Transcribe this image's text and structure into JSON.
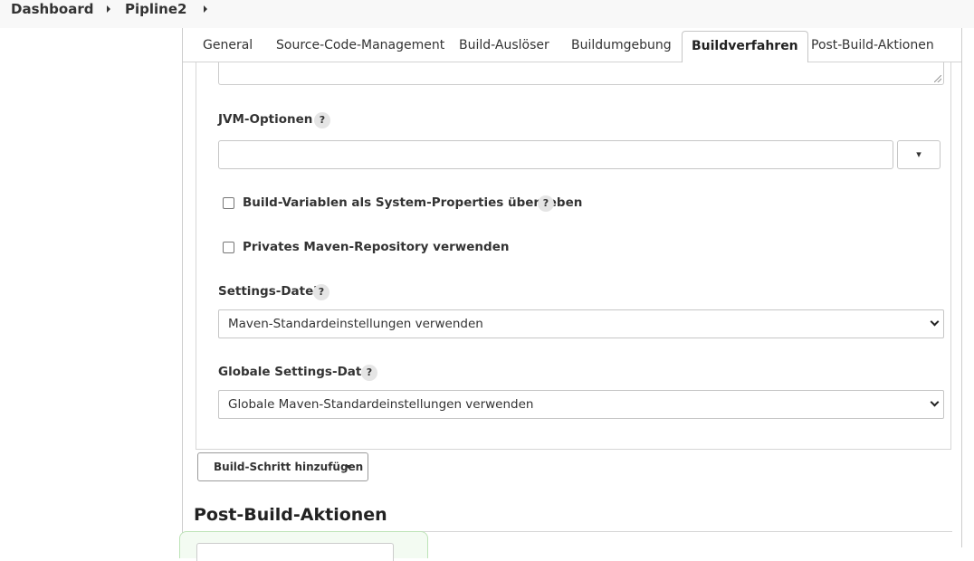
{
  "breadcrumb": {
    "items": [
      "Dashboard",
      "Pipline2"
    ]
  },
  "tabs": [
    {
      "label": "General"
    },
    {
      "label": "Source-Code-Management"
    },
    {
      "label": "Build-Auslöser"
    },
    {
      "label": "Buildumgebung"
    },
    {
      "label": "Buildverfahren",
      "active": true
    },
    {
      "label": "Post-Build-Aktionen"
    }
  ],
  "form": {
    "jvm_options": {
      "label": "JVM-Optionen",
      "help": "?",
      "value": "",
      "toggle_icon": "▾"
    },
    "build_variables": {
      "label": "Build-Variablen als System-Properties übergeben",
      "help": "?",
      "checked": false
    },
    "private_repo": {
      "label": "Privates Maven-Repository verwenden",
      "checked": false
    },
    "settings_file": {
      "label": "Settings-Datei",
      "help": "?",
      "selected": "Maven-Standardeinstellungen verwenden"
    },
    "global_settings_file": {
      "label": "Globale Settings-Datei",
      "help": "?",
      "selected": "Globale Maven-Standardeinstellungen verwenden"
    }
  },
  "actions": {
    "add_build_step": "Build-Schritt hinzufügen"
  },
  "post_build": {
    "heading": "Post-Build-Aktionen"
  }
}
